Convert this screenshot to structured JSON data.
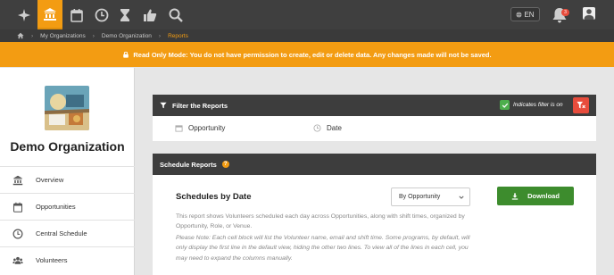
{
  "nav": {
    "icons": [
      "plane-icon",
      "bank-icon",
      "calendar-icon",
      "clock-icon",
      "hourglass-icon",
      "thumbs-up-icon",
      "search-icon"
    ],
    "active_index": 1,
    "language": "EN",
    "notification_count": "3"
  },
  "breadcrumb": {
    "items": [
      "My Organizations",
      "Demo Organization",
      "Reports"
    ]
  },
  "banner": {
    "text": "Read Only Mode: You do not have permission to create, edit or delete data. Any changes made will not be saved."
  },
  "sidebar": {
    "org_name": "Demo Organization",
    "items": [
      {
        "label": "Overview",
        "icon": "bank-icon"
      },
      {
        "label": "Opportunities",
        "icon": "calendar-icon"
      },
      {
        "label": "Central Schedule",
        "icon": "clock-icon"
      },
      {
        "label": "Volunteers",
        "icon": "users-icon"
      }
    ]
  },
  "filter": {
    "title": "Filter the Reports",
    "note": "Indicates filter is on",
    "options": [
      "Opportunity",
      "Date"
    ]
  },
  "schedule": {
    "header": "Schedule Reports",
    "title": "Schedules by Date",
    "select_value": "By Opportunity",
    "download_label": "Download",
    "description": "This report shows Volunteers scheduled each day across Opportunities, along with shift times, organized by Opportunity, Role, or Venue.",
    "note": "Please Note: Each cell block will list the Volunteer name, email and shift time. Some programs, by default, will only display the first line in the default view, hiding the other two lines. To view all of the lines in each cell, you may need to expand the columns manually."
  },
  "colors": {
    "accent": "#f39c12",
    "dark": "#3d3d3d",
    "success": "#3d8c2d",
    "danger": "#e74c3c"
  }
}
